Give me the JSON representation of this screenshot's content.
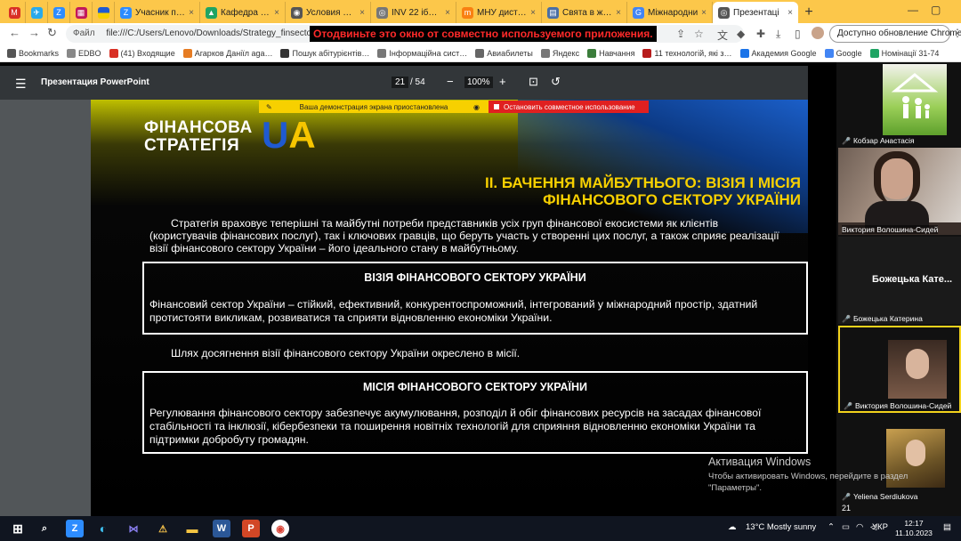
{
  "browser": {
    "tabs": [
      {
        "type": "pin",
        "icon": "gmail-icon",
        "color": "#d93025",
        "glyph": "M"
      },
      {
        "type": "pin",
        "icon": "telegram-icon",
        "color": "#29a9eb",
        "glyph": "✈"
      },
      {
        "type": "pin",
        "icon": "zoom-icon",
        "color": "#2d8cff",
        "glyph": "Z"
      },
      {
        "type": "pin",
        "icon": "app-icon",
        "color": "#c2185b",
        "glyph": "▦"
      },
      {
        "type": "pin",
        "icon": "ukraine-flag-icon",
        "color": "#f7d000",
        "glyph": ""
      },
      {
        "type": "reg",
        "title": "Учасник пуб",
        "icon": "zoom-icon",
        "color": "#2d8cff",
        "glyph": "Z"
      },
      {
        "type": "reg",
        "title": "Кафедра еко",
        "icon": "drive-icon",
        "color": "#1fa463",
        "glyph": "▲"
      },
      {
        "type": "reg",
        "title": "Условия пуб",
        "icon": "page-icon",
        "color": "#555555",
        "glyph": "◉"
      },
      {
        "type": "reg",
        "title": "INV 22 іб+ас",
        "icon": "globe-icon",
        "color": "#777777",
        "glyph": "◎"
      },
      {
        "type": "reg",
        "title": "МНУ дистан",
        "icon": "moodle-icon",
        "color": "#f98012",
        "glyph": "m"
      },
      {
        "type": "reg",
        "title": "Свята в жов",
        "icon": "page-icon",
        "color": "#4a6fa5",
        "glyph": "▤"
      },
      {
        "type": "reg",
        "title": "Міжнародни",
        "icon": "google-icon",
        "color": "#4285f4",
        "glyph": "G"
      },
      {
        "type": "active",
        "title": "Презентаці",
        "icon": "globe-icon",
        "color": "#555555",
        "glyph": "◎"
      }
    ],
    "new_tab": "+",
    "url_label": "Файл",
    "url": "file:///C:/Users/Lenovo/Downloads/Strategy_finsecto",
    "disconnect": "Отодвиньте это окно от совместно используемого приложения.",
    "update_button": "Доступно обновление Chrome",
    "bookmarks": [
      {
        "label": "Bookmarks",
        "color": "#555555"
      },
      {
        "label": "EDBO",
        "color": "#888888"
      },
      {
        "label": "(41) Входящие",
        "color": "#d93025"
      },
      {
        "label": "Агарков Даніїл aga…",
        "color": "#e67c23"
      },
      {
        "label": "Пошук абітурієнтів…",
        "color": "#333333"
      },
      {
        "label": "Інформаційна сист…",
        "color": "#777777"
      },
      {
        "label": "Авиабилеты",
        "color": "#666666"
      },
      {
        "label": "Яндекс",
        "color": "#777777"
      },
      {
        "label": "Навчання",
        "color": "#3b7d3b"
      },
      {
        "label": "11 технологій, які з…",
        "color": "#b71c1c"
      },
      {
        "label": "Академия Google",
        "color": "#1a73e8"
      },
      {
        "label": "Google",
        "color": "#4285f4"
      },
      {
        "label": "Номінації 31-74",
        "color": "#1fa463"
      }
    ]
  },
  "pdf": {
    "title": "Презентация PowerPoint",
    "page": "21",
    "total": "/ 54",
    "zoom": "100%",
    "minus": "−",
    "plus": "+"
  },
  "share_banner": {
    "paused": "Ваша демонстрация экрана приостановлена",
    "stop": "Остановить совместное использование"
  },
  "slide": {
    "logo_line1": "ФІНАНСОВА",
    "logo_line2": "СТРАТЕГІЯ",
    "logo_u": "U",
    "logo_a": "A",
    "heading_line1": "ІІ. БАЧЕННЯ МАЙБУТНЬОГО: ВІЗІЯ І МІСІЯ",
    "heading_line2": "ФІНАНСОВОГО СЕКТОРУ УКРАЇНИ",
    "intro_line1": "Стратегія враховує теперішні та майбутні потреби представників усіх груп фінансової екосистеми як клієнтів",
    "intro_line2": "(користувачів фінансових послуг), так і ключових гравців, що беруть участь у створенні цих послуг, а також сприяє реалізації",
    "intro_line3": "візії фінансового сектору України – його ідеального стану в майбутньому.",
    "vision_title": "ВІЗІЯ ФІНАНСОВОГО СЕКТОРУ УКРАЇНИ",
    "vision_line1": "Фінансовий сектор України – стійкий, ефективний, конкурентоспроможний, інтегрований у міжнародний простір, здатний",
    "vision_line2": "протистояти викликам, розвиватися та сприяти відновленню економіки України.",
    "path_text": "Шлях досягнення візії фінансового сектору України окреслено в місії.",
    "mission_title": "МІСІЯ ФІНАНСОВОГО СЕКТОРУ УКРАЇНИ",
    "mission_line1": "Регулювання фінансового сектору забезпечує акумулювання, розподіл й обіг фінансових ресурсів на засадах фінансової",
    "mission_line2": "стабільності та інклюзії, кібербезпеки та поширення новітніх технологій для сприяння відновленню економіки України та",
    "mission_line3": "підтримки добробуту громадян."
  },
  "watermark": {
    "title": "Активация Windows",
    "text": "Чтобы активировать Windows, перейдите в раздел \"Параметры\"."
  },
  "participants": [
    {
      "name": "Кобзар Анастасія",
      "muted": true
    },
    {
      "name": "Виктория Волошина-Сидей",
      "muted": false
    },
    {
      "name_big": "Божецька Кате...",
      "name": "Божецька Катерина",
      "muted": true
    },
    {
      "name": "Виктория Волошина-Сидей",
      "muted": true
    },
    {
      "name": "Yeliena Serdiukova",
      "muted": true
    }
  ],
  "page_badge": "21",
  "taskbar": {
    "weather": "13°C  Mostly sunny",
    "lang": "УКР",
    "time": "12:17",
    "date": "11.10.2023"
  }
}
